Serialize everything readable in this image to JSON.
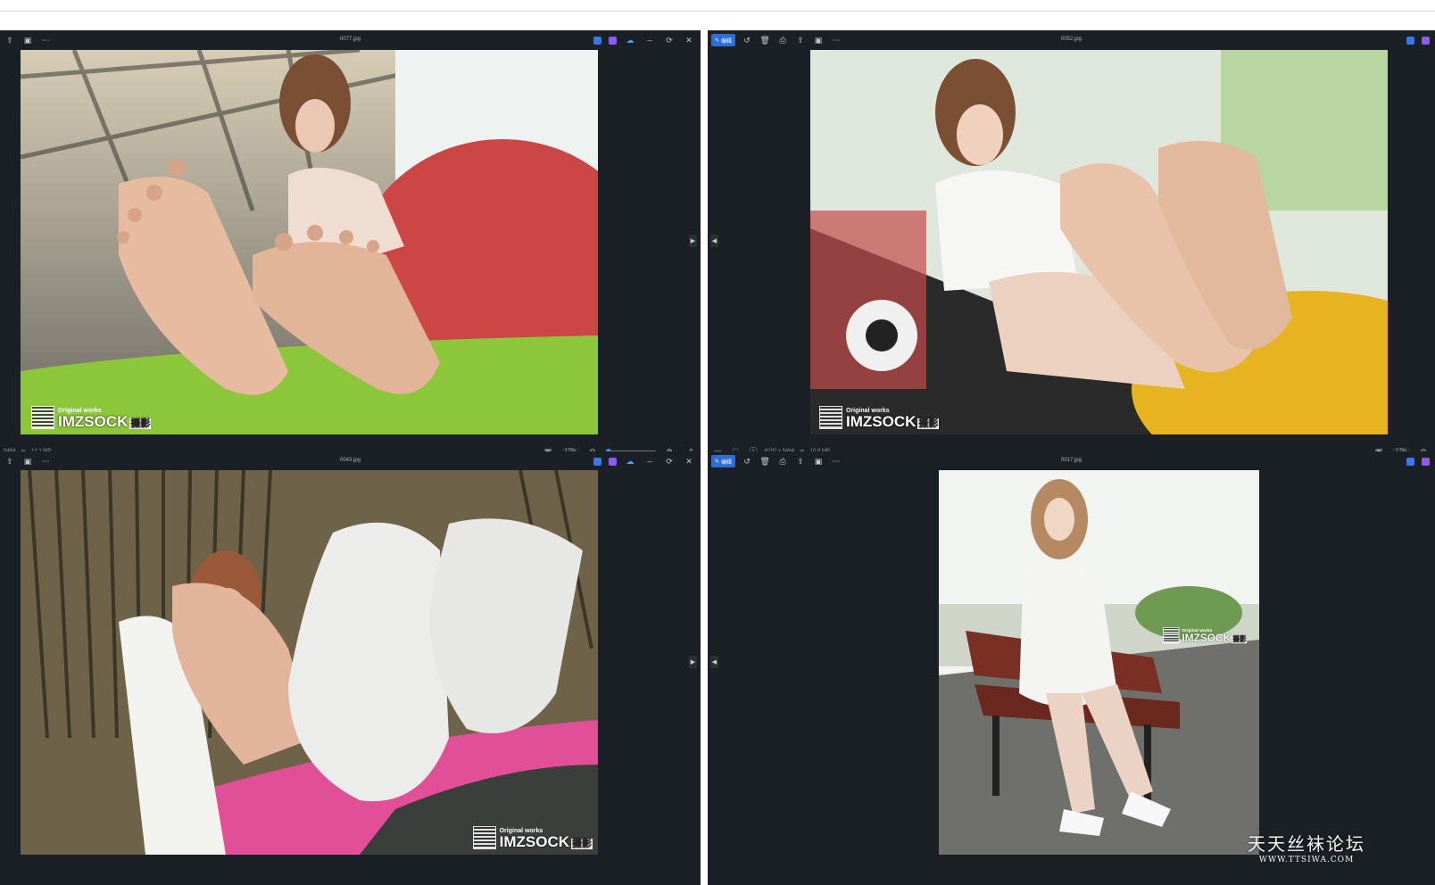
{
  "viewers": [
    {
      "file_name": "0077.jpg",
      "status": {
        "dimensions": "5464",
        "file_size": "12.1 MB",
        "zoom": "17%"
      },
      "watermark": {
        "top": "Original works",
        "brand": "IMZSOCK",
        "suffix": "摄影"
      }
    },
    {
      "file_name": "0052.jpg",
      "edit_label": "编辑",
      "status": {
        "dimensions": "8192 x 5464",
        "file_size": "10.8 MB",
        "zoom": "17%"
      },
      "watermark": {
        "top": "Original works",
        "brand": "IMZSOCK",
        "suffix": "摄影"
      }
    },
    {
      "file_name": "0043.jpg",
      "watermark": {
        "top": "Original works",
        "brand": "IMZSOCK",
        "suffix": "摄影"
      }
    },
    {
      "file_name": "0017.jpg",
      "edit_label": "编辑",
      "watermark": {
        "top": "Original works",
        "brand": "IMZSOCK",
        "suffix": "摄影"
      }
    }
  ],
  "forum_watermark": {
    "title": "天天丝袜论坛",
    "url": "WWW.TTSIWA.COM"
  },
  "colors": {
    "viewer_bg": "#1b2026",
    "accent": "#2b6fd6"
  }
}
